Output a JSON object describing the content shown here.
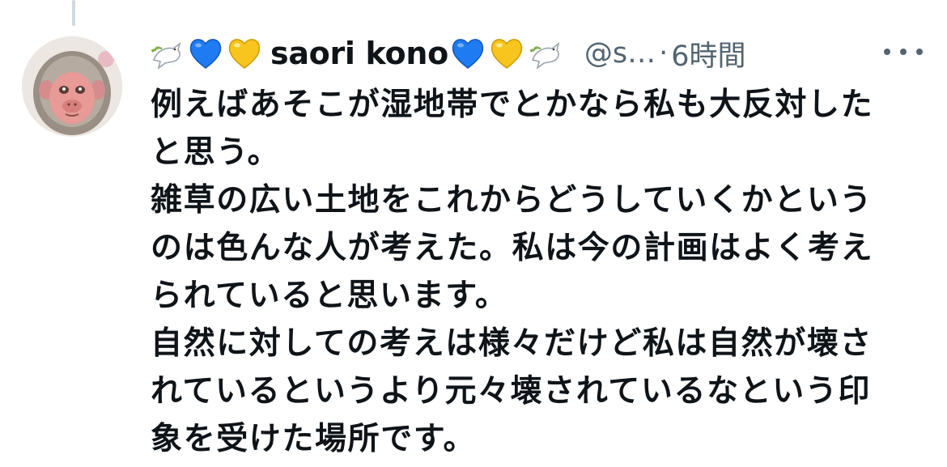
{
  "post": {
    "name_emoji_prefix": [
      "dove-icon",
      "blue-heart-icon",
      "yellow-heart-icon"
    ],
    "display_name": "saori kono",
    "name_emoji_suffix": [
      "blue-heart-icon",
      "yellow-heart-icon",
      "dove-icon"
    ],
    "handle": "@s…",
    "separator": "·",
    "time": "6時間",
    "more_icon": "more-icon",
    "avatar_icon": "monkey-avatar",
    "lines": [
      "例えばあそこが湿地帯でとかなら私も大反対した",
      "と思う。",
      "雑草の広い土地をこれからどうしていくかという",
      "のは色んな人が考えた。私は今の計画はよく考え",
      "られていると思います。",
      "自然に対しての考えは様々だけど私は自然が壊さ",
      "れているというより元々壊されているなという印",
      "象を受けた場所です。"
    ]
  },
  "colors": {
    "text": "#0f1419",
    "secondary": "#536471",
    "thread_line": "#cfd9de",
    "blue_heart": "#1f7bf2",
    "yellow_heart": "#f7c51e"
  }
}
